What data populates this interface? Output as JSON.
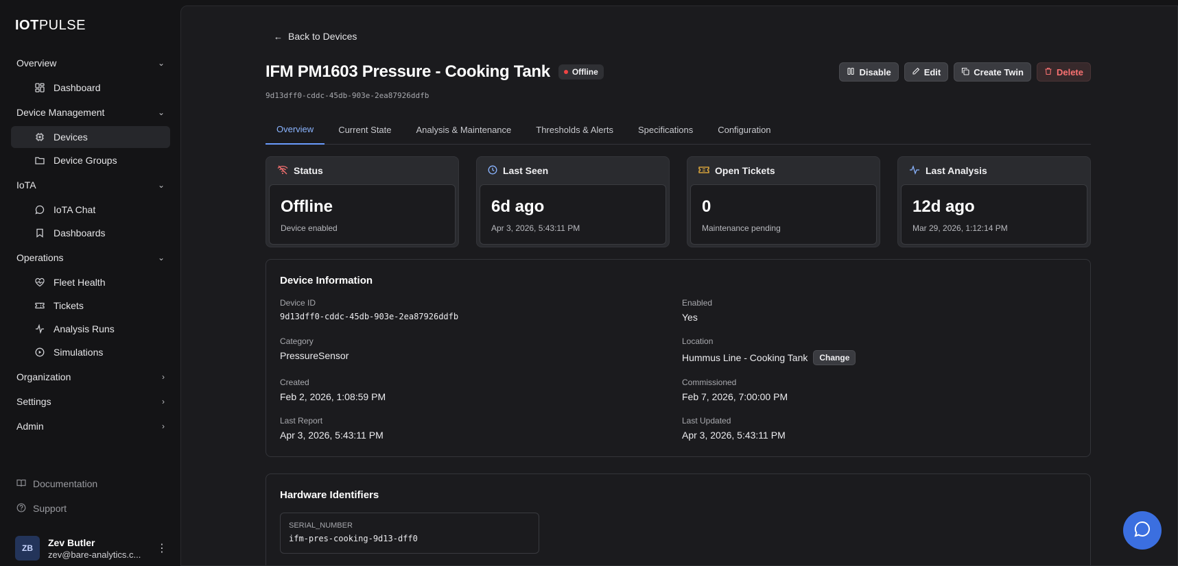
{
  "brand": {
    "part1": "IOT",
    "part2": "PULSE"
  },
  "sidebar": {
    "sections": [
      {
        "label": "Overview",
        "expanded": true,
        "items": [
          {
            "label": "Dashboard",
            "icon": "dashboard-icon"
          }
        ]
      },
      {
        "label": "Device Management",
        "expanded": true,
        "items": [
          {
            "label": "Devices",
            "icon": "chip-icon",
            "active": true
          },
          {
            "label": "Device Groups",
            "icon": "folder-icon"
          }
        ]
      },
      {
        "label": "IoTA",
        "expanded": true,
        "items": [
          {
            "label": "IoTA Chat",
            "icon": "chat-icon"
          },
          {
            "label": "Dashboards",
            "icon": "bookmark-icon"
          }
        ]
      },
      {
        "label": "Operations",
        "expanded": true,
        "items": [
          {
            "label": "Fleet Health",
            "icon": "heart-pulse-icon"
          },
          {
            "label": "Tickets",
            "icon": "ticket-icon"
          },
          {
            "label": "Analysis Runs",
            "icon": "activity-icon"
          },
          {
            "label": "Simulations",
            "icon": "play-circle-icon"
          }
        ]
      },
      {
        "label": "Organization",
        "expanded": false
      },
      {
        "label": "Settings",
        "expanded": false
      },
      {
        "label": "Admin",
        "expanded": false
      }
    ],
    "footer": {
      "documentation": "Documentation",
      "support": "Support"
    },
    "user": {
      "initials": "ZB",
      "name": "Zev Butler",
      "email": "zev@bare-analytics.c..."
    }
  },
  "header": {
    "back_label": "Back to Devices",
    "title": "IFM PM1603 Pressure - Cooking Tank",
    "status_badge": "Offline",
    "device_uuid": "9d13dff0-cddc-45db-903e-2ea87926ddfb",
    "actions": {
      "disable": "Disable",
      "edit": "Edit",
      "create_twin": "Create Twin",
      "delete": "Delete"
    }
  },
  "tabs": [
    {
      "label": "Overview",
      "active": true
    },
    {
      "label": "Current State"
    },
    {
      "label": "Analysis & Maintenance"
    },
    {
      "label": "Thresholds & Alerts"
    },
    {
      "label": "Specifications"
    },
    {
      "label": "Configuration"
    }
  ],
  "cards": [
    {
      "title": "Status",
      "icon": "wifi-off-icon",
      "icon_color": "#f87171",
      "value": "Offline",
      "sub": "Device enabled"
    },
    {
      "title": "Last Seen",
      "icon": "clock-icon",
      "icon_color": "#8ab4ff",
      "value": "6d ago",
      "sub": "Apr 3, 2026, 5:43:11 PM"
    },
    {
      "title": "Open Tickets",
      "icon": "ticket-icon",
      "icon_color": "#f5b83d",
      "value": "0",
      "sub": "Maintenance pending"
    },
    {
      "title": "Last Analysis",
      "icon": "activity-icon",
      "icon_color": "#8ab4ff",
      "value": "12d ago",
      "sub": "Mar 29, 2026, 1:12:14 PM"
    }
  ],
  "device_info": {
    "title": "Device Information",
    "device_id_label": "Device ID",
    "device_id": "9d13dff0-cddc-45db-903e-2ea87926ddfb",
    "enabled_label": "Enabled",
    "enabled": "Yes",
    "category_label": "Category",
    "category": "PressureSensor",
    "location_label": "Location",
    "location": "Hummus Line - Cooking Tank",
    "change_label": "Change",
    "created_label": "Created",
    "created": "Feb 2, 2026, 1:08:59 PM",
    "commissioned_label": "Commissioned",
    "commissioned": "Feb 7, 2026, 7:00:00 PM",
    "last_report_label": "Last Report",
    "last_report": "Apr 3, 2026, 5:43:11 PM",
    "last_updated_label": "Last Updated",
    "last_updated": "Apr 3, 2026, 5:43:11 PM"
  },
  "hardware": {
    "title": "Hardware Identifiers",
    "key": "SERIAL_NUMBER",
    "value": "ifm-pres-cooking-9d13-dff0"
  },
  "colors": {
    "accent": "#6a9cff",
    "danger": "#f87171",
    "fab": "#3b6fe0"
  }
}
